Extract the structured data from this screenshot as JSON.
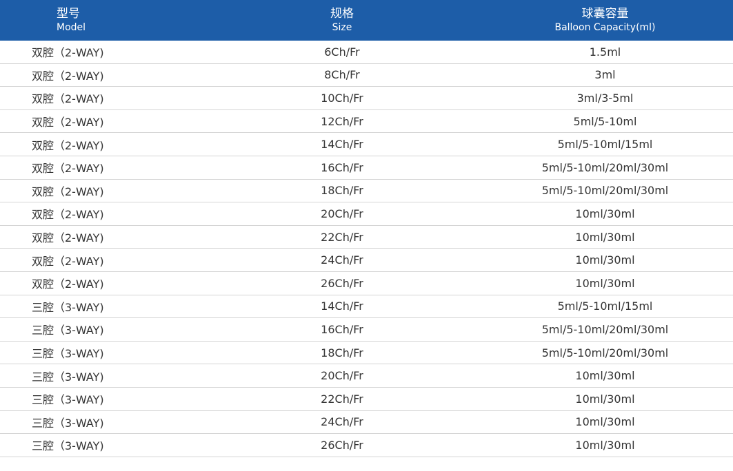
{
  "header": {
    "model": {
      "cn": "型号",
      "en": "Model"
    },
    "size": {
      "cn": "规格",
      "en": "Size"
    },
    "capacity": {
      "cn": "球囊容量",
      "en": "Balloon Capacity(ml)"
    }
  },
  "rows": [
    {
      "model": "双腔（2-WAY)",
      "size": "6Ch/Fr",
      "capacity": "1.5ml"
    },
    {
      "model": "双腔（2-WAY)",
      "size": "8Ch/Fr",
      "capacity": "3ml"
    },
    {
      "model": "双腔（2-WAY)",
      "size": "10Ch/Fr",
      "capacity": "3ml/3-5ml"
    },
    {
      "model": "双腔（2-WAY)",
      "size": "12Ch/Fr",
      "capacity": "5ml/5-10ml"
    },
    {
      "model": "双腔（2-WAY)",
      "size": "14Ch/Fr",
      "capacity": "5ml/5-10ml/15ml"
    },
    {
      "model": "双腔（2-WAY)",
      "size": "16Ch/Fr",
      "capacity": "5ml/5-10ml/20ml/30ml"
    },
    {
      "model": "双腔（2-WAY)",
      "size": "18Ch/Fr",
      "capacity": "5ml/5-10ml/20ml/30ml"
    },
    {
      "model": "双腔（2-WAY)",
      "size": "20Ch/Fr",
      "capacity": "10ml/30ml"
    },
    {
      "model": "双腔（2-WAY)",
      "size": "22Ch/Fr",
      "capacity": "10ml/30ml"
    },
    {
      "model": "双腔（2-WAY)",
      "size": "24Ch/Fr",
      "capacity": "10ml/30ml"
    },
    {
      "model": "双腔（2-WAY)",
      "size": "26Ch/Fr",
      "capacity": "10ml/30ml"
    },
    {
      "model": "三腔（3-WAY)",
      "size": "14Ch/Fr",
      "capacity": "5ml/5-10ml/15ml"
    },
    {
      "model": "三腔（3-WAY)",
      "size": "16Ch/Fr",
      "capacity": "5ml/5-10ml/20ml/30ml"
    },
    {
      "model": "三腔（3-WAY)",
      "size": "18Ch/Fr",
      "capacity": "5ml/5-10ml/20ml/30ml"
    },
    {
      "model": "三腔（3-WAY)",
      "size": "20Ch/Fr",
      "capacity": "10ml/30ml"
    },
    {
      "model": "三腔（3-WAY)",
      "size": "22Ch/Fr",
      "capacity": "10ml/30ml"
    },
    {
      "model": "三腔（3-WAY)",
      "size": "24Ch/Fr",
      "capacity": "10ml/30ml"
    },
    {
      "model": "三腔（3-WAY)",
      "size": "26Ch/Fr",
      "capacity": "10ml/30ml"
    }
  ],
  "colors": {
    "header_bg": "#1d5da8",
    "header_text": "#ffffff",
    "body_text": "#333333",
    "row_divider": "#d4d4d4"
  }
}
